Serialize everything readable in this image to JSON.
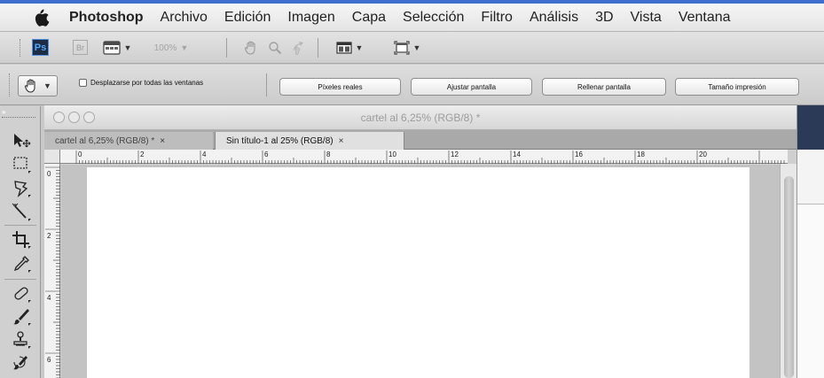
{
  "menubar": {
    "apple_icon": "apple-logo-icon",
    "items": [
      "Photoshop",
      "Archivo",
      "Edición",
      "Imagen",
      "Capa",
      "Selección",
      "Filtro",
      "Análisis",
      "3D",
      "Vista",
      "Ventana"
    ]
  },
  "appbar": {
    "ps_logo": "Ps",
    "bridge_label": "Br",
    "zoom_value": "100%",
    "icons": [
      "mini-bridge-icon",
      "hand-icon",
      "zoom-icon",
      "rotate-view-icon",
      "arrange-documents-icon",
      "screen-mode-icon"
    ]
  },
  "options": {
    "tool_preset_icon": "hand-icon",
    "scroll_all_label": "Desplazarse por todas las ventanas",
    "scroll_all_checked": false,
    "buttons": [
      "Píxeles reales",
      "Ajustar pantalla",
      "Rellenar pantalla",
      "Tamaño impresión"
    ]
  },
  "document": {
    "window_title": "cartel al 6,25% (RGB/8) *",
    "tabs": [
      {
        "label": "cartel al 6,25% (RGB/8) *",
        "close": "×",
        "active": false
      },
      {
        "label": "Sin título-1 al 25% (RGB/8)",
        "close": "×",
        "active": true
      }
    ],
    "hruler_labels": [
      "0",
      "2",
      "4",
      "6",
      "8",
      "10",
      "12",
      "14",
      "16",
      "18",
      "20"
    ],
    "vruler_labels": [
      "0",
      "2",
      "4",
      "6"
    ]
  },
  "tools": [
    "move-tool-icon",
    "marquee-tool-icon",
    "lasso-tool-icon",
    "magic-wand-tool-icon",
    "crop-tool-icon",
    "eyedropper-tool-icon",
    "healing-brush-tool-icon",
    "brush-tool-icon",
    "clone-stamp-tool-icon",
    "history-brush-tool-icon"
  ],
  "colors": {
    "accent_blue": "#3f6fcf",
    "ps_logo_bg": "#1e2c44",
    "ps_logo_text": "#52a8ff",
    "canvas": "#ffffff",
    "pasteboard": "#c3c3c3"
  }
}
